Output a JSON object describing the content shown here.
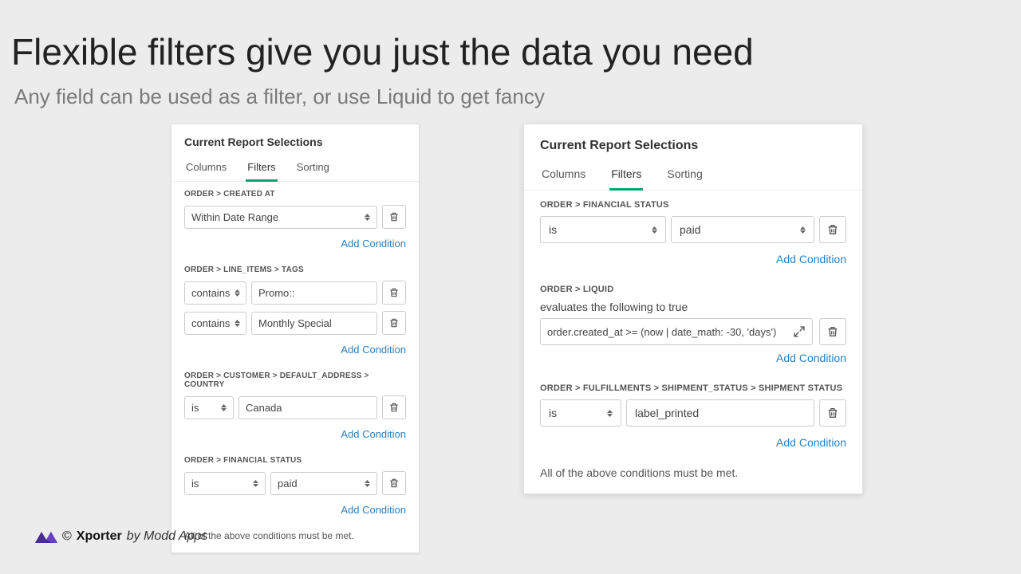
{
  "title": "Flexible filters give you just the data you need",
  "subtitle": "Any field can be used as a filter, or use Liquid to get fancy",
  "panel": {
    "heading": "Current Report Selections",
    "tabs": [
      "Columns",
      "Filters",
      "Sorting"
    ],
    "active_tab": "Filters",
    "add_condition": "Add Condition",
    "footer": "All of the above conditions must be met."
  },
  "left": {
    "groups": [
      {
        "label": "ORDER > CREATED AT",
        "rows": [
          {
            "type": "wide-select",
            "value": "Within Date Range"
          }
        ]
      },
      {
        "label": "ORDER > LINE_ITEMS > TAGS",
        "rows": [
          {
            "type": "op-input",
            "op": "contains",
            "value": "Promo::"
          },
          {
            "type": "op-input",
            "op": "contains",
            "value": "Monthly Special"
          }
        ]
      },
      {
        "label": "ORDER > CUSTOMER > DEFAULT_ADDRESS > COUNTRY",
        "rows": [
          {
            "type": "op-input",
            "op": "is",
            "value": "Canada"
          }
        ]
      },
      {
        "label": "ORDER > FINANCIAL STATUS",
        "rows": [
          {
            "type": "op-select",
            "op": "is",
            "value": "paid"
          }
        ]
      }
    ]
  },
  "right": {
    "groups": [
      {
        "label": "ORDER > FINANCIAL STATUS",
        "rows": [
          {
            "type": "op-select",
            "op": "is",
            "value": "paid"
          }
        ]
      },
      {
        "label": "ORDER > LIQUID",
        "note": "evaluates the following to true",
        "rows": [
          {
            "type": "liquid",
            "value": "order.created_at >= (now | date_math: -30, 'days')"
          }
        ]
      },
      {
        "label": "ORDER > FULFILLMENTS > SHIPMENT_STATUS > SHIPMENT STATUS",
        "rows": [
          {
            "type": "op-input-b",
            "op": "is",
            "value": "label_printed"
          }
        ]
      }
    ]
  },
  "brand": {
    "copyright": "©",
    "name": "Xporter",
    "by": "by Modd Apps"
  },
  "colors": {
    "accent": "#00a66e",
    "link": "#2a7fc1"
  }
}
